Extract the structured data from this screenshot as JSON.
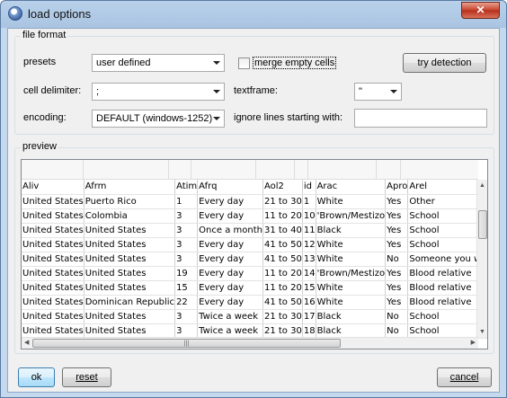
{
  "window": {
    "title": "load options",
    "close_label": "✕"
  },
  "file_format": {
    "group_label": "file format",
    "presets_label": "presets",
    "presets_value": "user defined",
    "merge_label": "merge empty cells",
    "merge_checked": false,
    "try_detection_label": "try detection",
    "cell_delimiter_label": "cell delimiter:",
    "cell_delimiter_value": ";",
    "textframe_label": "textframe:",
    "textframe_value": "\"",
    "encoding_label": "encoding:",
    "encoding_value": "DEFAULT (windows-1252)",
    "ignore_label": "ignore lines starting with:",
    "ignore_value": ""
  },
  "preview": {
    "group_label": "preview",
    "columns": [
      "Aliv",
      "Afrm",
      "Atim",
      "Afrq",
      "Aol2",
      "id",
      "Arac",
      "Apro",
      "Arel"
    ],
    "rows": [
      [
        "United States",
        "Puerto Rico",
        "1",
        "Every day",
        "21 to 30",
        "1",
        "White",
        "Yes",
        "Other"
      ],
      [
        "United States",
        "Colombia",
        "3",
        "Every day",
        "11 to 20",
        "10",
        "'Brown/Mestizo",
        "Yes",
        "School"
      ],
      [
        "United States",
        "United States",
        "3",
        "Once a month",
        "31 to 40",
        "11",
        "Black",
        "Yes",
        "School"
      ],
      [
        "United States",
        "United States",
        "3",
        "Every day",
        "41 to 50",
        "12",
        "White",
        "Yes",
        "School"
      ],
      [
        "United States",
        "United States",
        "3",
        "Every day",
        "41 to 50",
        "13",
        "White",
        "No",
        "Someone you wou"
      ],
      [
        "United States",
        "United States",
        "19",
        "Every day",
        "11 to 20",
        "14",
        "'Brown/Mestizo",
        "Yes",
        "Blood relative"
      ],
      [
        "United States",
        "United States",
        "15",
        "Every day",
        "11 to 20",
        "15",
        "White",
        "Yes",
        "Blood relative"
      ],
      [
        "United States",
        "Dominican Republic",
        "22",
        "Every day",
        "41 to 50",
        "16",
        "White",
        "Yes",
        "Blood relative"
      ],
      [
        "United States",
        "United States",
        "3",
        "Twice a week",
        "21 to 30",
        "17",
        "Black",
        "No",
        "School"
      ],
      [
        "United States",
        "United States",
        "3",
        "Twice a week",
        "21 to 30",
        "18",
        "Black",
        "No",
        "School"
      ]
    ]
  },
  "buttons": {
    "ok": "ok",
    "reset": "reset",
    "cancel": "cancel"
  }
}
